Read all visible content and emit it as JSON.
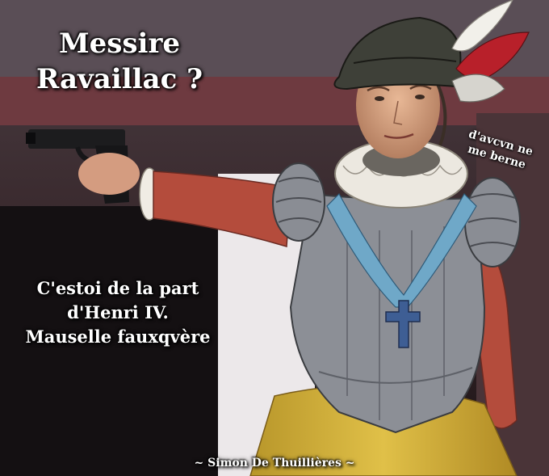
{
  "title": {
    "line1": "Messire",
    "line2": "Ravaillac ?"
  },
  "quote": {
    "line1": "C'estoi de la part",
    "line2": "d'Henri IV.",
    "line3": "Mauselle fauxqvère"
  },
  "aside": {
    "line1": "d'avcvn ne",
    "line2": "me berne"
  },
  "credit": "~ Simon De Thuillières ~",
  "colors": {
    "text": "#ffffff",
    "sleeve": "#b44c3c",
    "armor": "#8c8f96",
    "sash": "#6fa8c8",
    "skirt": "#d4b43c",
    "hat": "#3e4038",
    "feather_red": "#b8202a"
  }
}
